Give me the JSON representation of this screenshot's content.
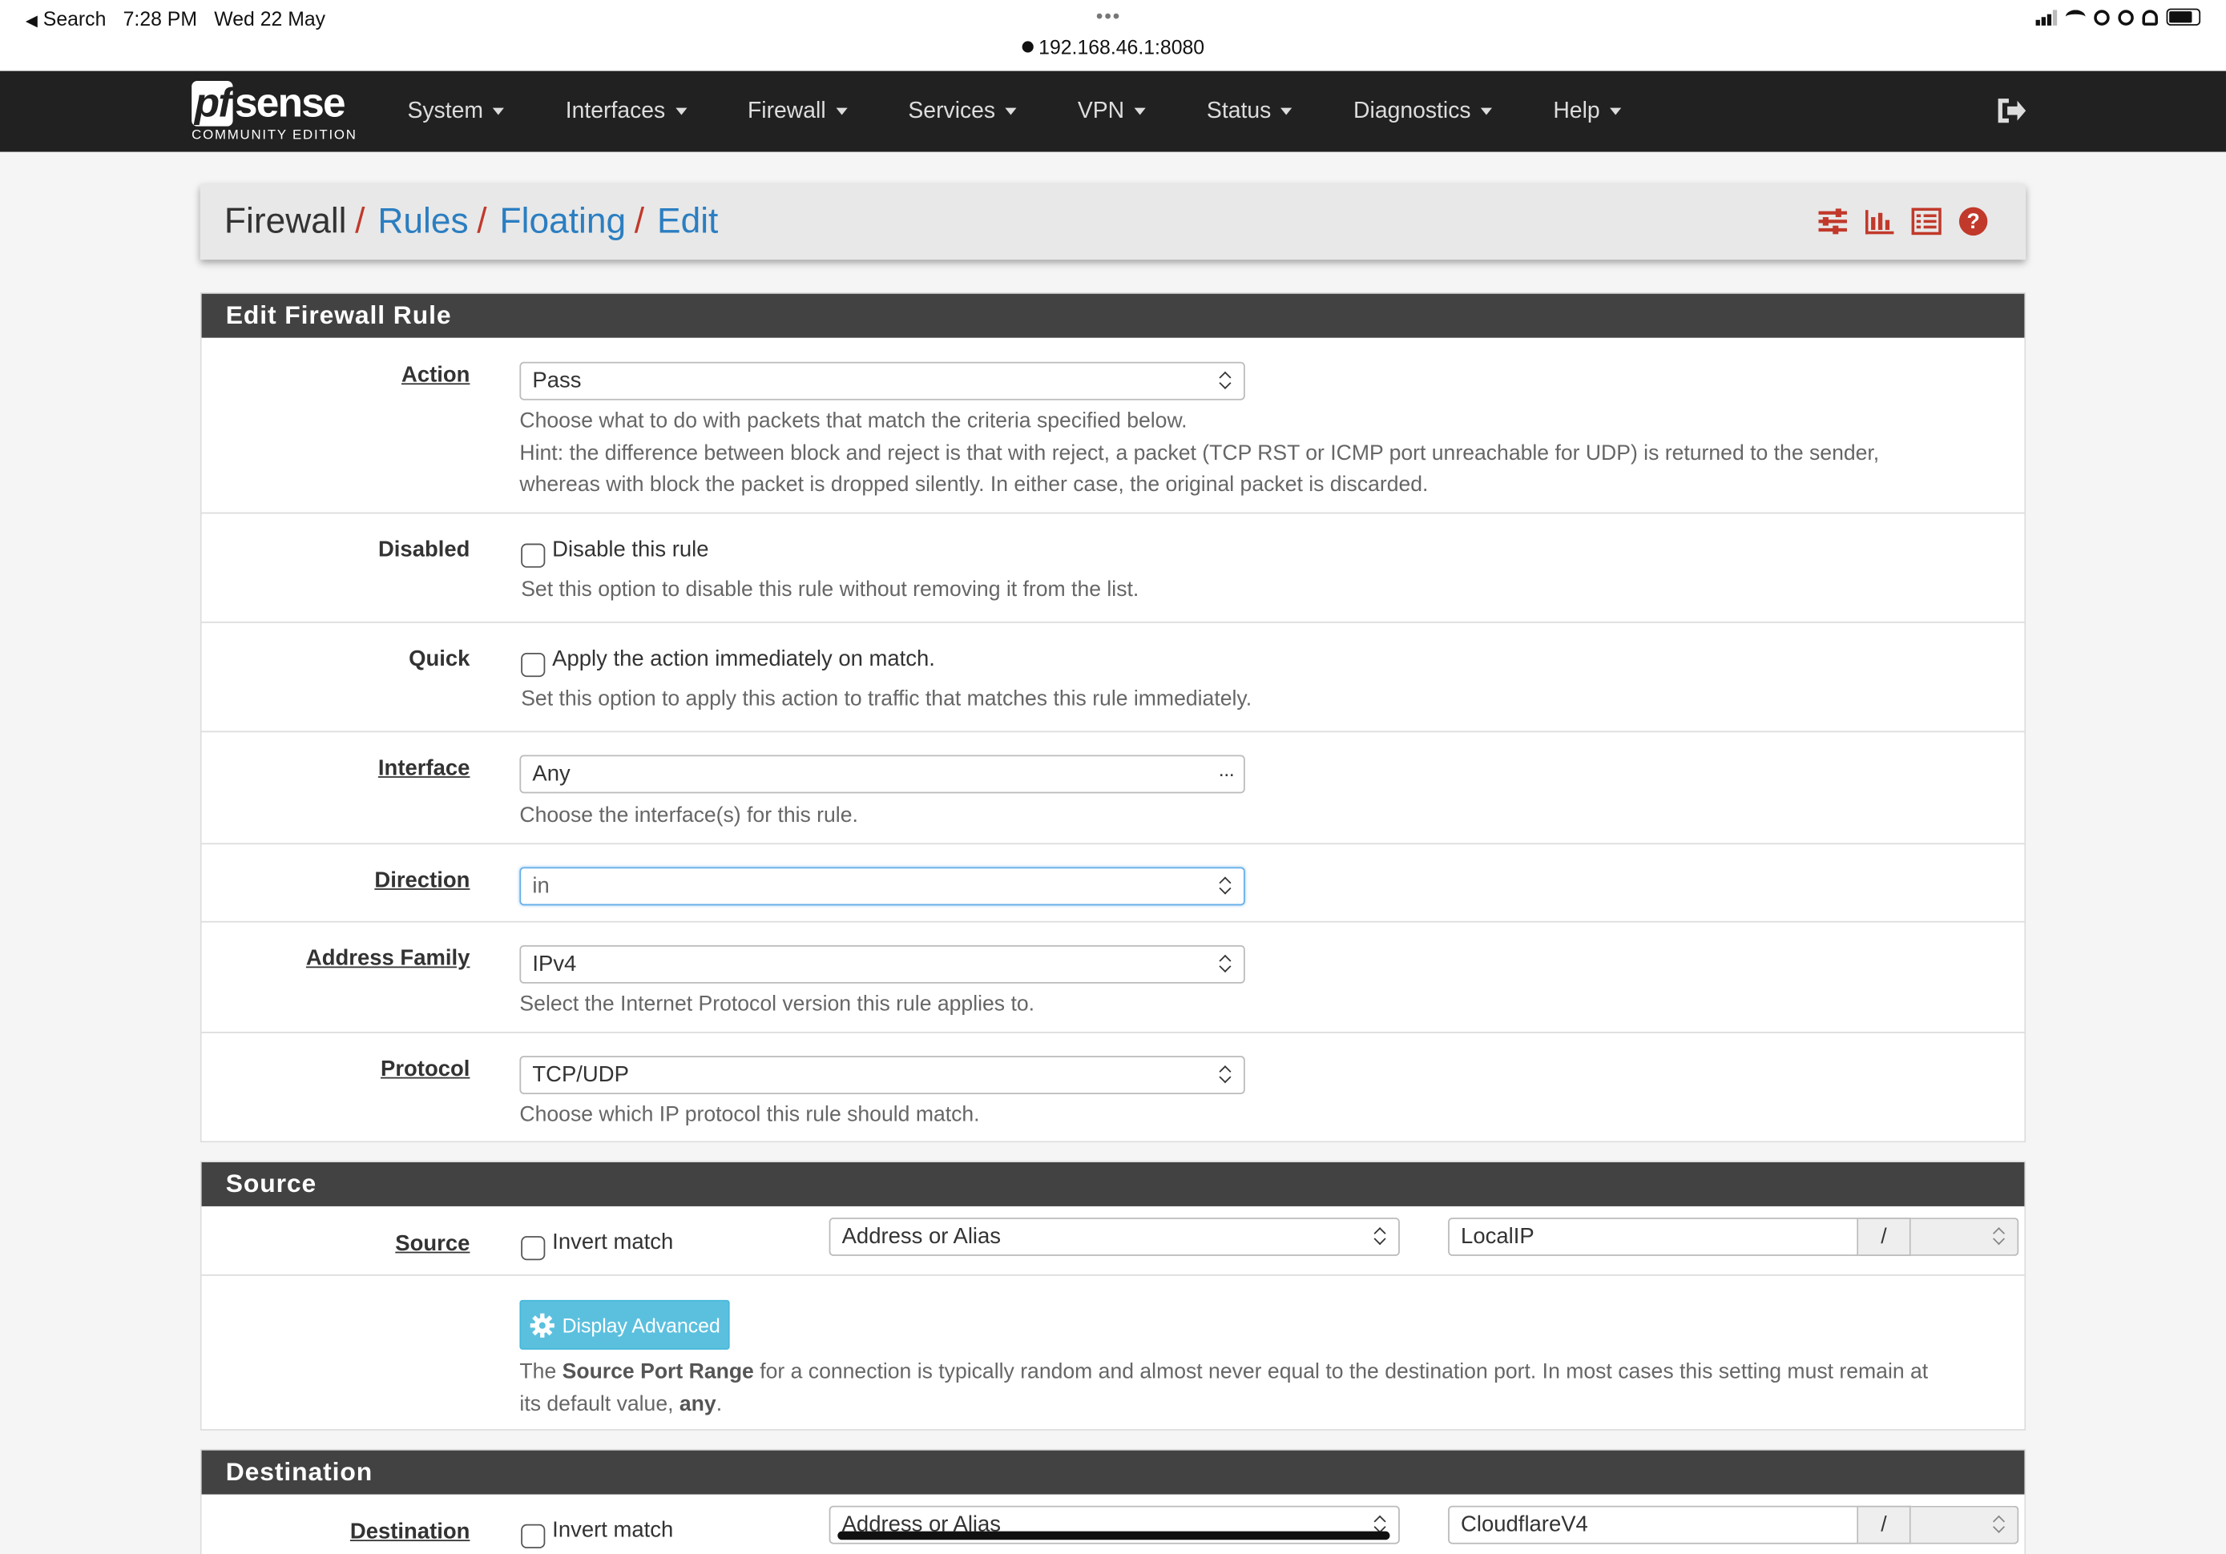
{
  "statusbar": {
    "back": "Search",
    "time": "7:28 PM",
    "date": "Wed 22 May",
    "url": "192.168.46.1:8080"
  },
  "navbar": {
    "logo_brand_a": "pf",
    "logo_brand_b": "sense",
    "logo_edition": "COMMUNITY EDITION",
    "menu": [
      "System",
      "Interfaces",
      "Firewall",
      "Services",
      "VPN",
      "Status",
      "Diagnostics",
      "Help"
    ]
  },
  "breadcrumb": {
    "root": "Firewall",
    "links": [
      "Rules",
      "Floating",
      "Edit"
    ],
    "separator": "/"
  },
  "edit_panel": {
    "title": "Edit Firewall Rule",
    "action": {
      "label": "Action",
      "value": "Pass",
      "help1": "Choose what to do with packets that match the criteria specified below.",
      "help2": "Hint: the difference between block and reject is that with reject, a packet (TCP RST or ICMP port unreachable for UDP) is returned to the sender,",
      "help3": "whereas with block the packet is dropped silently. In either case, the original packet is discarded."
    },
    "disabled": {
      "label": "Disabled",
      "checkbox": "Disable this rule",
      "help": "Set this option to disable this rule without removing it from the list."
    },
    "quick": {
      "label": "Quick",
      "checkbox": "Apply the action immediately on match.",
      "help": "Set this option to apply this action to traffic that matches this rule immediately."
    },
    "interface": {
      "label": "Interface",
      "value": "Any",
      "help": "Choose the interface(s) for this rule."
    },
    "direction": {
      "label": "Direction",
      "value": "in"
    },
    "address_family": {
      "label": "Address Family",
      "value": "IPv4",
      "help": "Select the Internet Protocol version this rule applies to."
    },
    "protocol": {
      "label": "Protocol",
      "value": "TCP/UDP",
      "help": "Choose which IP protocol this rule should match."
    }
  },
  "source_panel": {
    "title": "Source",
    "label": "Source",
    "invert": "Invert match",
    "type": "Address or Alias",
    "address": "LocalIP",
    "slash": "/",
    "advanced_button": "Display Advanced",
    "help_pre": "The ",
    "help_bold1": "Source Port Range",
    "help_mid": " for a connection is typically random and almost never equal to the destination port. In most cases this setting must remain at",
    "help_line2_pre": "its default value, ",
    "help_bold2": "any",
    "help_end": "."
  },
  "destination_panel": {
    "title": "Destination",
    "label": "Destination",
    "invert": "Invert match",
    "type": "Address or Alias",
    "address": "CloudflareV4",
    "slash": "/"
  },
  "colors": {
    "navbar": "#212121",
    "panel_header": "#424242",
    "link": "#2b7ec1",
    "accent_red": "#c1392b",
    "info_button": "#5bc0de"
  }
}
